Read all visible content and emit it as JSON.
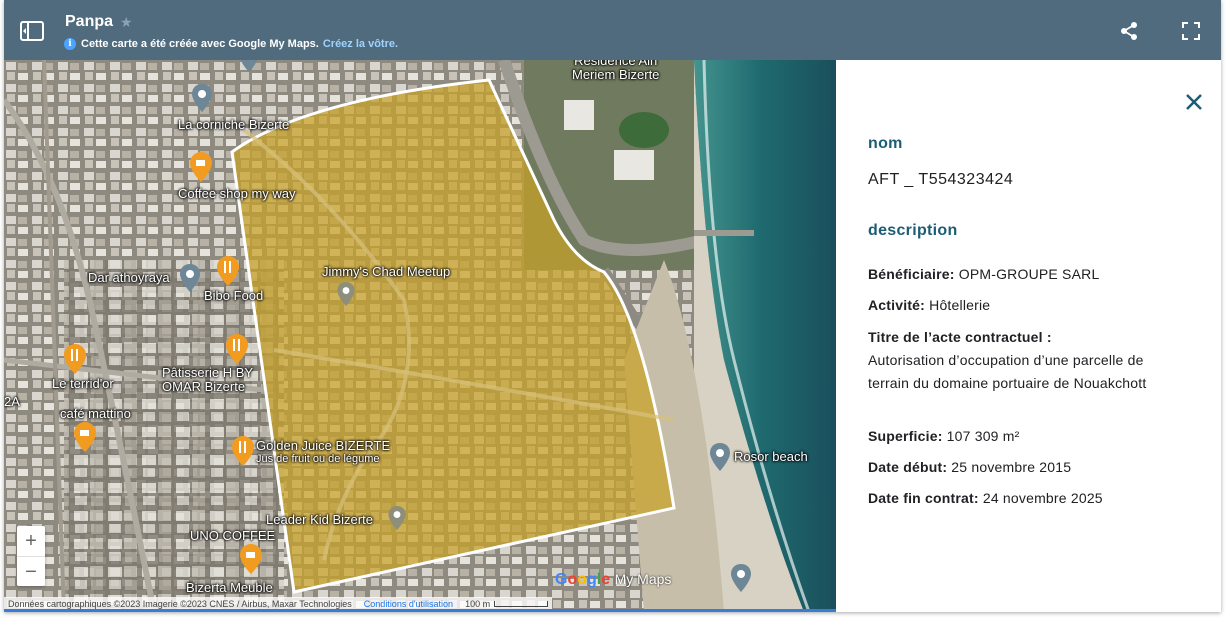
{
  "header": {
    "title": "Panpa",
    "notice": "Cette carte a été créée avec Google My Maps.",
    "create_link": "Créez la vôtre.",
    "info_glyph": "i"
  },
  "map": {
    "pois": [
      {
        "label": "Résidence Ain\nMeriem Bizerte",
        "icon": "building-icon"
      },
      {
        "label": "La corniche Bizerte",
        "icon": "pin-icon"
      },
      {
        "label": "Coffee shop my way",
        "icon": "coffee-icon"
      },
      {
        "label": "Dar athoyraya",
        "icon": "pin-icon"
      },
      {
        "label": "Bibo Food",
        "icon": "restaurant-icon"
      },
      {
        "label": "Jimmy's Chad Meetup",
        "icon": "pin-icon"
      },
      {
        "label": "Le terrid'or",
        "icon": "restaurant-icon"
      },
      {
        "label": "Pâtisserie H BY OMAR Bizerte",
        "icon": "restaurant-icon"
      },
      {
        "label": "café mattino",
        "icon": "coffee-icon"
      },
      {
        "label": "Golden Juice BIZERTE",
        "icon": "restaurant-icon"
      },
      {
        "label": "Jus de fruit ou de légume",
        "icon": ""
      },
      {
        "label": "Rosor beach",
        "icon": "pin-icon"
      },
      {
        "label": "Leader Kid Bizerte",
        "icon": "pin-icon"
      },
      {
        "label": "UNO COFFEE",
        "icon": "coffee-icon"
      },
      {
        "label": "Bizerta Meuble",
        "icon": "pin-icon"
      },
      {
        "label": "2A",
        "icon": ""
      }
    ],
    "zoom_in": "+",
    "zoom_out": "−",
    "attribution": "Données cartographiques ©2023 Imagerie ©2023 CNES / Airbus, Maxar Technologies",
    "terms": "Conditions d'utilisation",
    "scale": "100 m",
    "brand_google": "Google",
    "brand_mymaps": "My Maps",
    "polygon_fill": "#c9a227",
    "polygon_stroke": "#ffffff"
  },
  "panel": {
    "nom_heading": "nom",
    "nom_value": "AFT _ T554323424",
    "description_heading": "description",
    "fields": [
      {
        "label": "Bénéficiaire:",
        "value": "OPM-GROUPE SARL"
      },
      {
        "label": "Activité:",
        "value": "Hôtellerie"
      },
      {
        "label": "Titre de l’acte contractuel :",
        "value": "Autorisation d’occupation d’une parcelle de terrain du domaine portuaire de Nouakchott"
      },
      {
        "label": "Superficie:",
        "value": "107 309 m²"
      },
      {
        "label": "Date début:",
        "value": "25 novembre 2015"
      },
      {
        "label": "Date fin contrat:",
        "value": "24 novembre 2025"
      }
    ],
    "heading_color": "#1c5d74"
  }
}
